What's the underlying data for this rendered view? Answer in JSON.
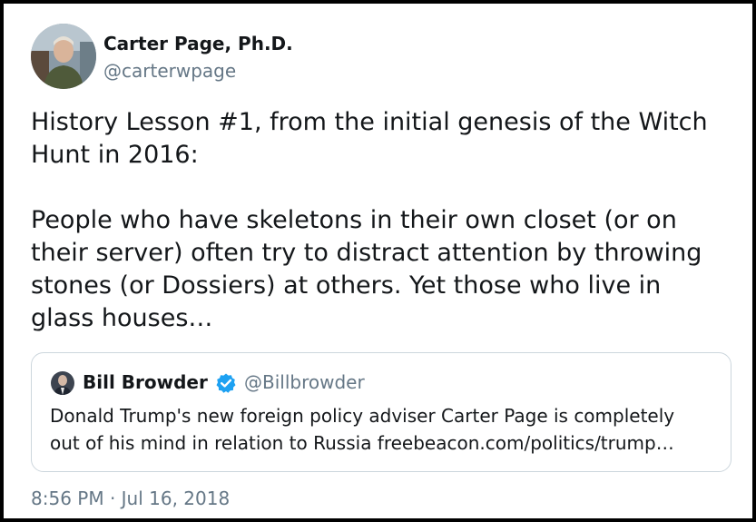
{
  "author": {
    "display_name": "Carter Page, Ph.D.",
    "handle": "@carterwpage"
  },
  "tweet": {
    "paragraph1_line1": "History Lesson #1, from the initial genesis of the Witch",
    "paragraph1_line2": "Hunt in 2016:",
    "paragraph2_line1": "People who have skeletons in their own closet (or on",
    "paragraph2_line2": "their server) often try to distract attention by throwing",
    "paragraph2_line3": "stones (or Dossiers) at others. Yet those who live in",
    "paragraph2_line4": "glass houses…"
  },
  "quoted_tweet": {
    "display_name": "Bill Browder",
    "verified_icon": "verified-badge-icon",
    "handle": "@Billbrowder",
    "text_line1": "Donald Trump's new foreign policy adviser Carter Page is completely",
    "text_line2": "out of his mind in relation to Russia freebeacon.com/politics/trump…"
  },
  "timestamp": "8:56 PM · Jul 16, 2018",
  "colors": {
    "text": "#14171a",
    "secondary": "#657786",
    "border": "#ccd6dd",
    "verified": "#1da1f2"
  }
}
